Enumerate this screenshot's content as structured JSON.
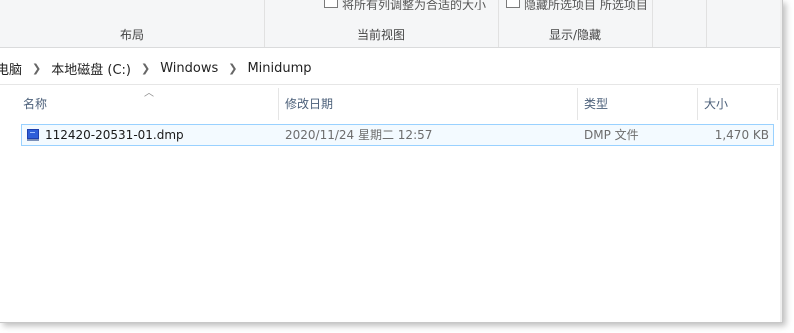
{
  "ribbon": {
    "groups": [
      {
        "label": "布局",
        "cut_text": ""
      },
      {
        "label": "当前视图",
        "cut_text": "将所有列调整为合适的大小"
      },
      {
        "label": "显示/隐藏",
        "cut_text": "隐藏所选项目  所选项目"
      }
    ]
  },
  "address": {
    "crumbs": [
      "电脑",
      "本地磁盘 (C:)",
      "Windows",
      "Minidump"
    ]
  },
  "columns": {
    "name": "名称",
    "modified": "修改日期",
    "type": "类型",
    "size": "大小"
  },
  "files": [
    {
      "name": "112420-20531-01.dmp",
      "modified": "2020/11/24 星期二 12:57",
      "type": "DMP 文件",
      "size": "1,470 KB",
      "icon": "dmp-file-icon"
    }
  ],
  "colors": {
    "header_text": "#4c607a",
    "selection_border": "#99d1ff",
    "selection_fill": "#f3faff"
  }
}
